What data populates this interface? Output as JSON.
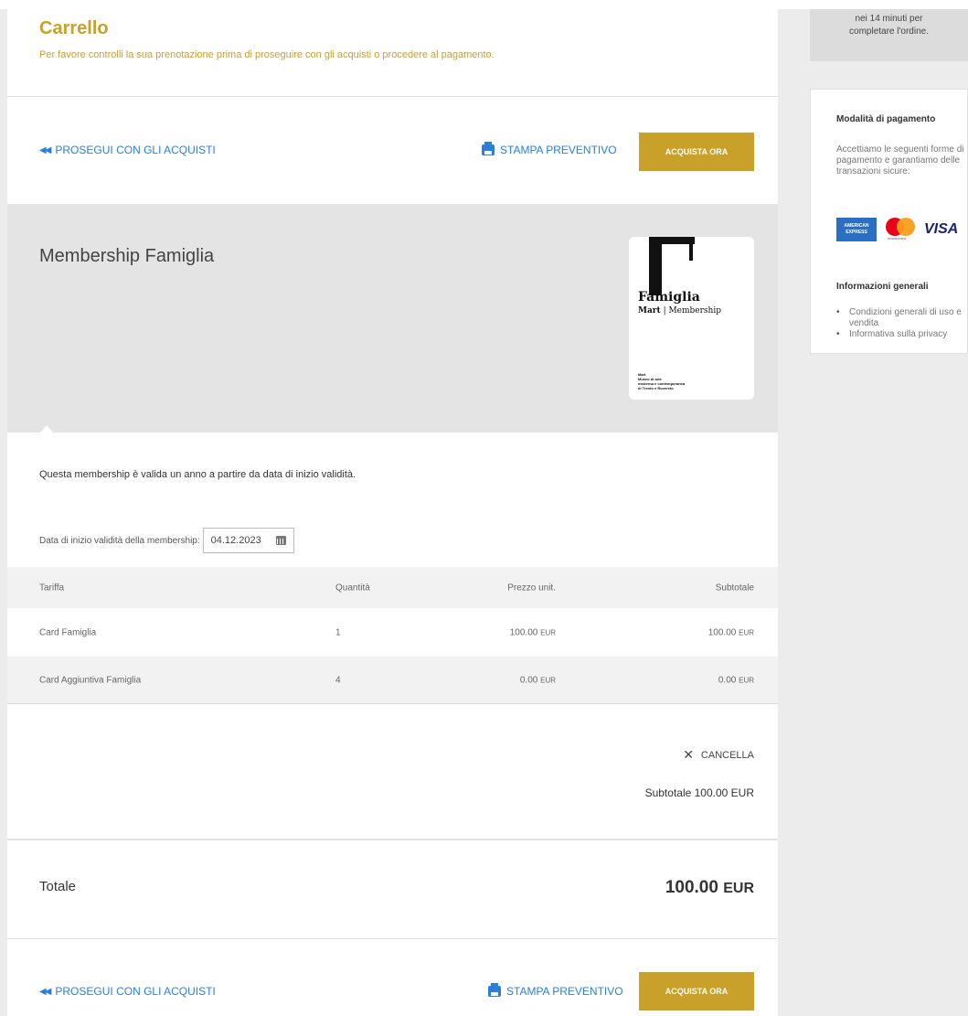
{
  "header": {
    "title": "Carrello",
    "subtitle": "Per favore controlli la sua prenotazione prima di proseguire con gli acquisti o procedere al pagamento."
  },
  "actions": {
    "continue_label": "PROSEGUI CON GLI ACQUISTI",
    "print_label": "STAMPA PREVENTIVO",
    "buy_label": "ACQUISTA ORA"
  },
  "product": {
    "name": "Membership Famiglia",
    "card_title": "Famiglia",
    "card_brand": "Mart",
    "card_type": "Membership",
    "card_small": [
      "Mart",
      "Museo di arte",
      "moderna e contemporanea",
      "di Trento e Rovereto"
    ]
  },
  "validity": {
    "text": "Questa membership è valida un anno a partire da data di inizio validità.",
    "date_label": "Data di inizio validità della membership:",
    "date_value": "04.12.2023"
  },
  "table": {
    "headers": [
      "Tariffa",
      "Quantità",
      "Prezzo unit.",
      "Subtotale"
    ],
    "rows": [
      {
        "tariff": "Card Famiglia",
        "qty": "1",
        "price": "100.00",
        "subtotal": "100.00"
      },
      {
        "tariff": "Card Aggiuntiva Famiglia",
        "qty": "4",
        "price": "0.00",
        "subtotal": "0.00"
      }
    ],
    "currency": "EUR"
  },
  "cancel_label": "CANCELLA",
  "subtotal_text": "Subtotale 100.00 EUR",
  "total": {
    "label": "Totale",
    "amount": "100.00",
    "currency": "EUR"
  },
  "sidebar": {
    "timer_text_line1": "nei 14 minuti per",
    "timer_text_line2": "completare l'ordine.",
    "payment_heading": "Modalità di pagamento",
    "payment_text": "Accettiamo le seguenti forme di pagamento e garantiamo delle transazioni sicure:",
    "amex_label_1": "AMERICAN",
    "amex_label_2": "EXPRESS",
    "mastercard_label": "mastercard",
    "visa_label": "VISA",
    "info_heading": "Informazioni generali",
    "links": [
      "Condizioni generali di uso e vendita",
      "Informativa sulla privacy"
    ]
  },
  "colors": {
    "accent": "#c9a02a",
    "link": "#2b7fd8",
    "product_bg": "#e4e4e4",
    "sidebar_bg": "#ececec"
  }
}
